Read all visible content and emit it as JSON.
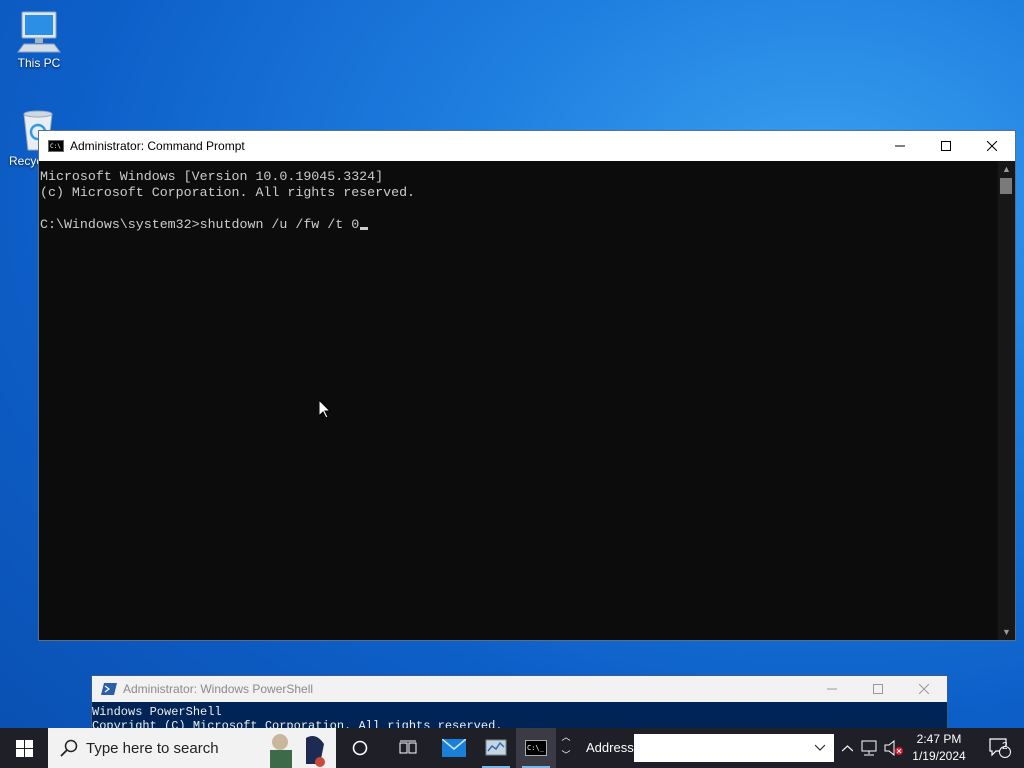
{
  "desktop": {
    "this_pc_label": "This PC",
    "recycle_bin_label": "Recyc"
  },
  "cmd_window": {
    "title": "Administrator: Command Prompt",
    "lines": [
      "Microsoft Windows [Version 10.0.19045.3324]",
      "(c) Microsoft Corporation. All rights reserved.",
      "",
      "C:\\Windows\\system32>shutdown /u /fw /t 0"
    ]
  },
  "ps_window": {
    "title": "Administrator: Windows PowerShell",
    "lines": [
      "Windows PowerShell",
      "Copyright (C) Microsoft Corporation. All rights reserved."
    ]
  },
  "taskbar": {
    "search_placeholder": "Type here to search",
    "address_label": "Address",
    "address_value": "",
    "clock_time": "2:47 PM",
    "clock_date": "1/19/2024",
    "notification_count": "2"
  },
  "colors": {
    "taskbar": "#1e1f27",
    "console_bg": "#0c0c0c",
    "powershell_bg": "#012456",
    "accent": "#76b9ed"
  }
}
